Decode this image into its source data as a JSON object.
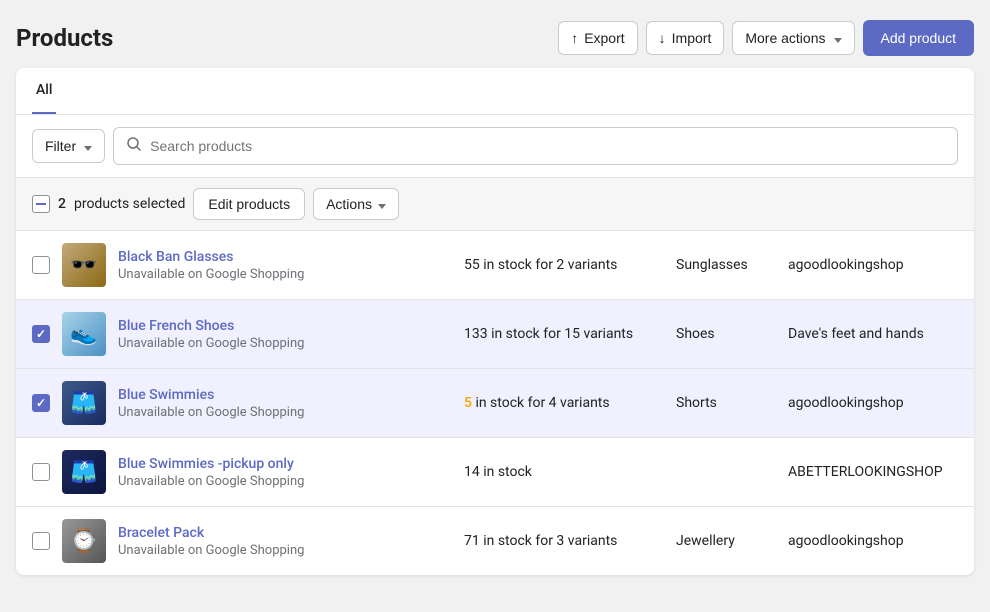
{
  "page": {
    "title": "Products",
    "add_product_label": "Add product"
  },
  "header_actions": {
    "export_label": "Export",
    "import_label": "Import",
    "more_actions_label": "More actions"
  },
  "tabs": [
    {
      "label": "All",
      "active": true
    }
  ],
  "toolbar": {
    "filter_label": "Filter",
    "search_placeholder": "Search products"
  },
  "selection_bar": {
    "count": "2",
    "products_selected_label": "products selected",
    "edit_products_label": "Edit products",
    "actions_label": "Actions"
  },
  "products": [
    {
      "id": 1,
      "name": "Black Ban Glasses",
      "subtitle": "Unavailable on Google Shopping",
      "stock": "55 in stock for 2 variants",
      "stock_warning": false,
      "stock_prefix": "",
      "stock_suffix": "55 in stock for 2 variants",
      "category": "Sunglasses",
      "shop": "agoodlookingshop",
      "selected": false,
      "image_type": "glasses",
      "image_emoji": "🕶️"
    },
    {
      "id": 2,
      "name": "Blue French Shoes",
      "subtitle": "Unavailable on Google Shopping",
      "stock": "133 in stock for 15 variants",
      "stock_warning": false,
      "stock_prefix": "",
      "stock_suffix": "133 in stock for 15 variants",
      "category": "Shoes",
      "shop": "Dave's feet and hands",
      "selected": true,
      "image_type": "shoes",
      "image_emoji": "👟"
    },
    {
      "id": 3,
      "name": "Blue Swimmies",
      "subtitle": "Unavailable on Google Shopping",
      "stock": " in stock for 4 variants",
      "stock_warning": true,
      "stock_prefix": "5",
      "stock_suffix": " in stock for 4 variants",
      "category": "Shorts",
      "shop": "agoodlookingshop",
      "selected": true,
      "image_type": "shorts",
      "image_emoji": "🩳"
    },
    {
      "id": 4,
      "name": "Blue Swimmies -pickup only",
      "subtitle": "Unavailable on Google Shopping",
      "stock": "14 in stock",
      "stock_warning": false,
      "stock_prefix": "",
      "stock_suffix": "14 in stock",
      "category": "",
      "shop": "ABETTERLOOKINGSHOP",
      "selected": false,
      "image_type": "shorts2",
      "image_emoji": "🩳"
    },
    {
      "id": 5,
      "name": "Bracelet Pack",
      "subtitle": "Unavailable on Google Shopping",
      "stock": "71 in stock for 3 variants",
      "stock_warning": false,
      "stock_prefix": "",
      "stock_suffix": "71 in stock for 3 variants",
      "category": "Jewellery",
      "shop": "agoodlookingshop",
      "selected": false,
      "image_type": "bracelet",
      "image_emoji": "⌚"
    }
  ]
}
